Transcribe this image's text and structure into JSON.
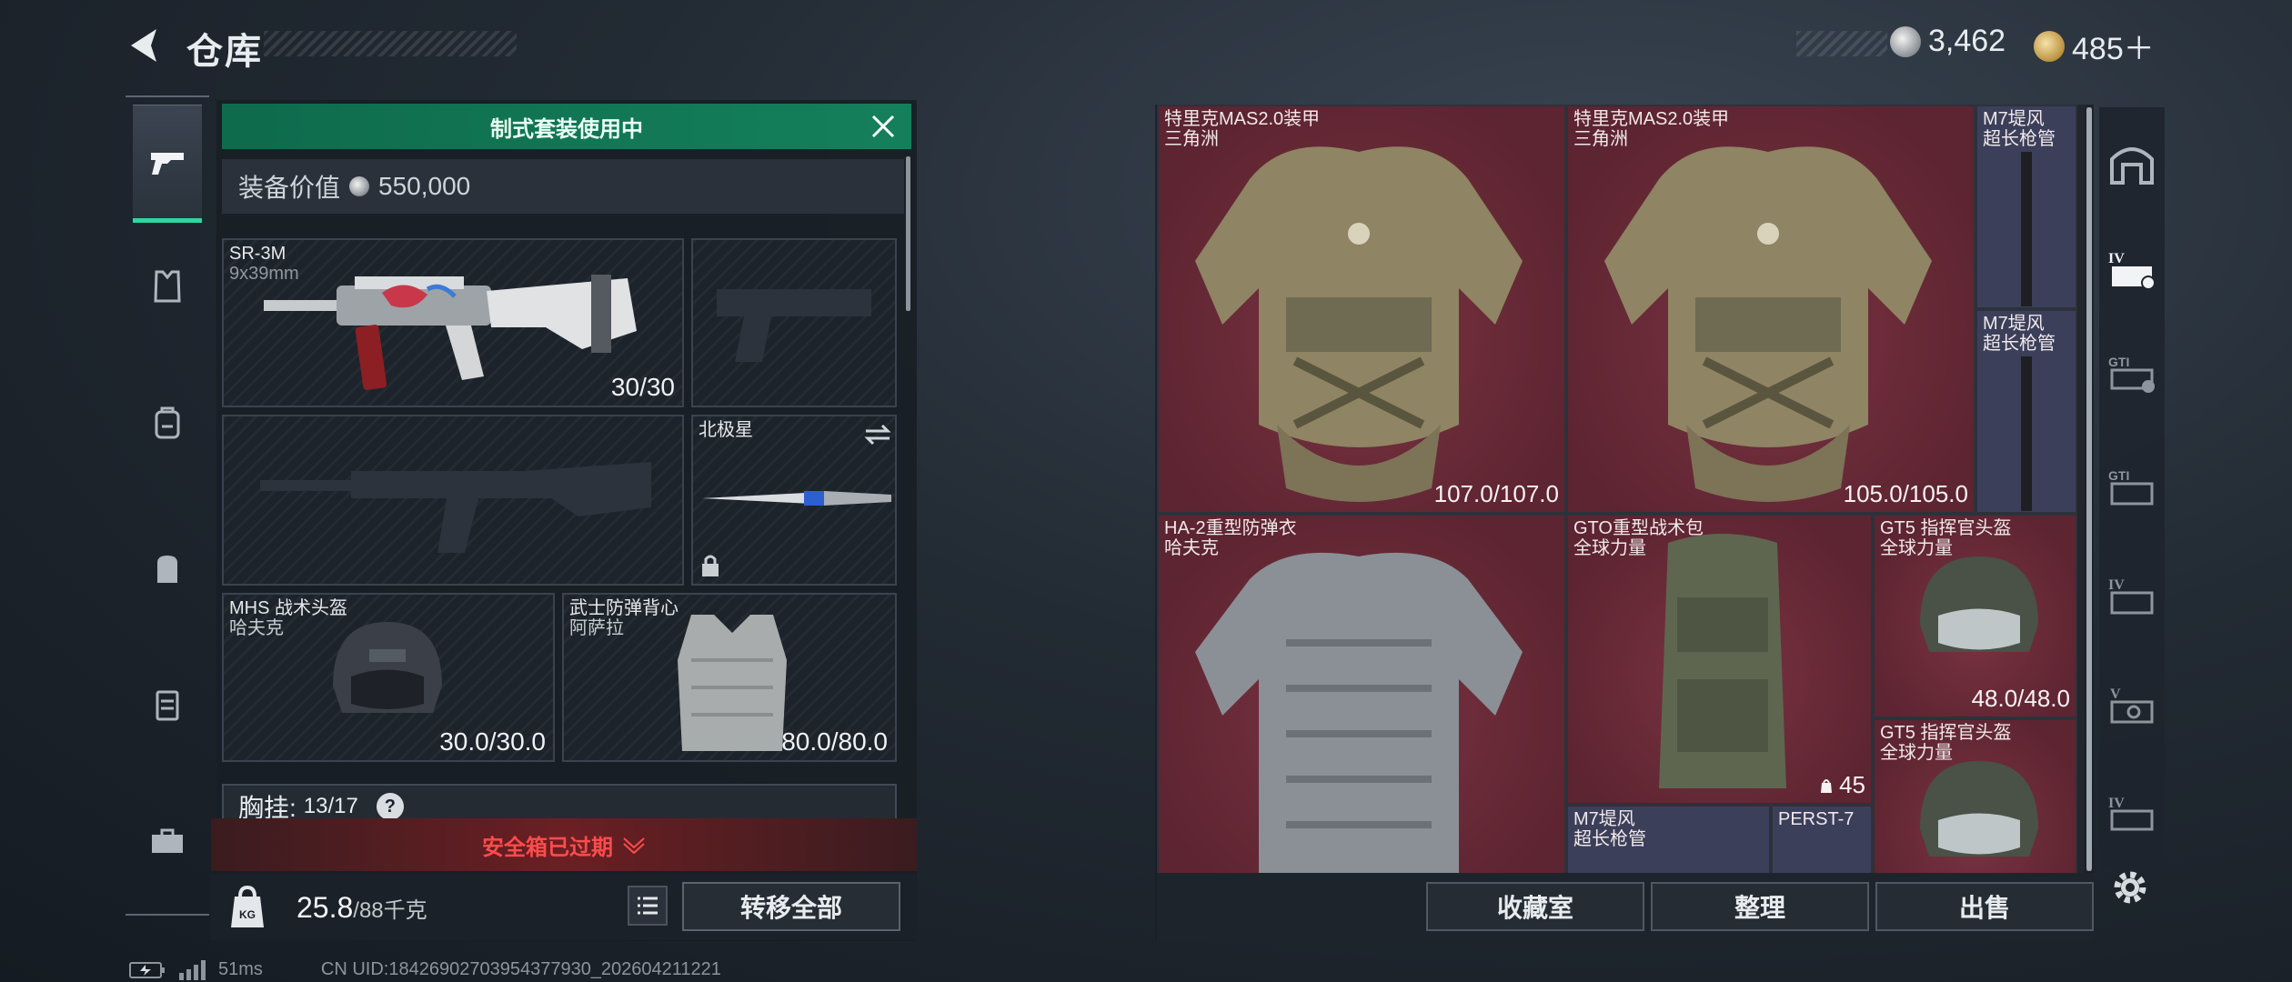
{
  "header": {
    "title": "仓库"
  },
  "currency": {
    "silver": "3,462",
    "gold": "485＋"
  },
  "rail": {
    "items": [
      "gun-icon",
      "vest-icon",
      "backpack-rig-icon",
      "backpack-icon",
      "case-icon",
      "toolbox-icon"
    ]
  },
  "loadout": {
    "banner": "制式套装使用中",
    "value_label": "装备价值",
    "value": "550,000",
    "primary": {
      "name": "SR-3M",
      "caliber": "9x39mm",
      "ammo": "30/30"
    },
    "knife": {
      "name": "北极星"
    },
    "helmet": {
      "name": "MHS 战术头盔",
      "maker": "哈夫克",
      "durability": "30.0/30.0"
    },
    "armor": {
      "name": "武士防弹背心",
      "maker": "阿萨拉",
      "durability": "80.0/80.0"
    },
    "chest_rig": {
      "label": "胸挂:",
      "capacity": "13/17",
      "help": "?"
    },
    "safe_box": "安全箱已过期",
    "weight_value": "25.8",
    "weight_max": "/88千克",
    "transfer_all": "转移全部"
  },
  "storage": {
    "items": [
      {
        "name": "特里克MAS2.0装甲",
        "maker": "三角洲",
        "durability": "107.0/107.0"
      },
      {
        "name": "特里克MAS2.0装甲",
        "maker": "三角洲",
        "durability": "105.0/105.0"
      },
      {
        "name": "M7堤风",
        "maker": "超长枪管"
      },
      {
        "name": "M7堤风",
        "maker": "超长枪管"
      },
      {
        "name": "HA-2重型防弹衣",
        "maker": "哈夫克"
      },
      {
        "name": "GTO重型战术包",
        "maker": "全球力量",
        "count": "45"
      },
      {
        "name": "GT5 指挥官头盔",
        "maker": "全球力量",
        "durability": "48.0/48.0"
      },
      {
        "name": "GT5 指挥官头盔",
        "maker": "全球力量"
      },
      {
        "name": "M7堤风",
        "maker": "超长枪管"
      },
      {
        "name": "PERST-7",
        "maker": ""
      }
    ],
    "actions": [
      "收藏室",
      "整理",
      "出售"
    ],
    "side_tabs": [
      "home-icon",
      "tier-4-storage-icon",
      "gti-storage-icon",
      "gti-storage-2-icon",
      "tier-4-storage-2-icon",
      "tier-5-storage-icon",
      "tier-4-storage-3-icon"
    ]
  },
  "status": {
    "ping": "51ms",
    "uid": "CN UID:18426902703954377930_202604211221"
  }
}
